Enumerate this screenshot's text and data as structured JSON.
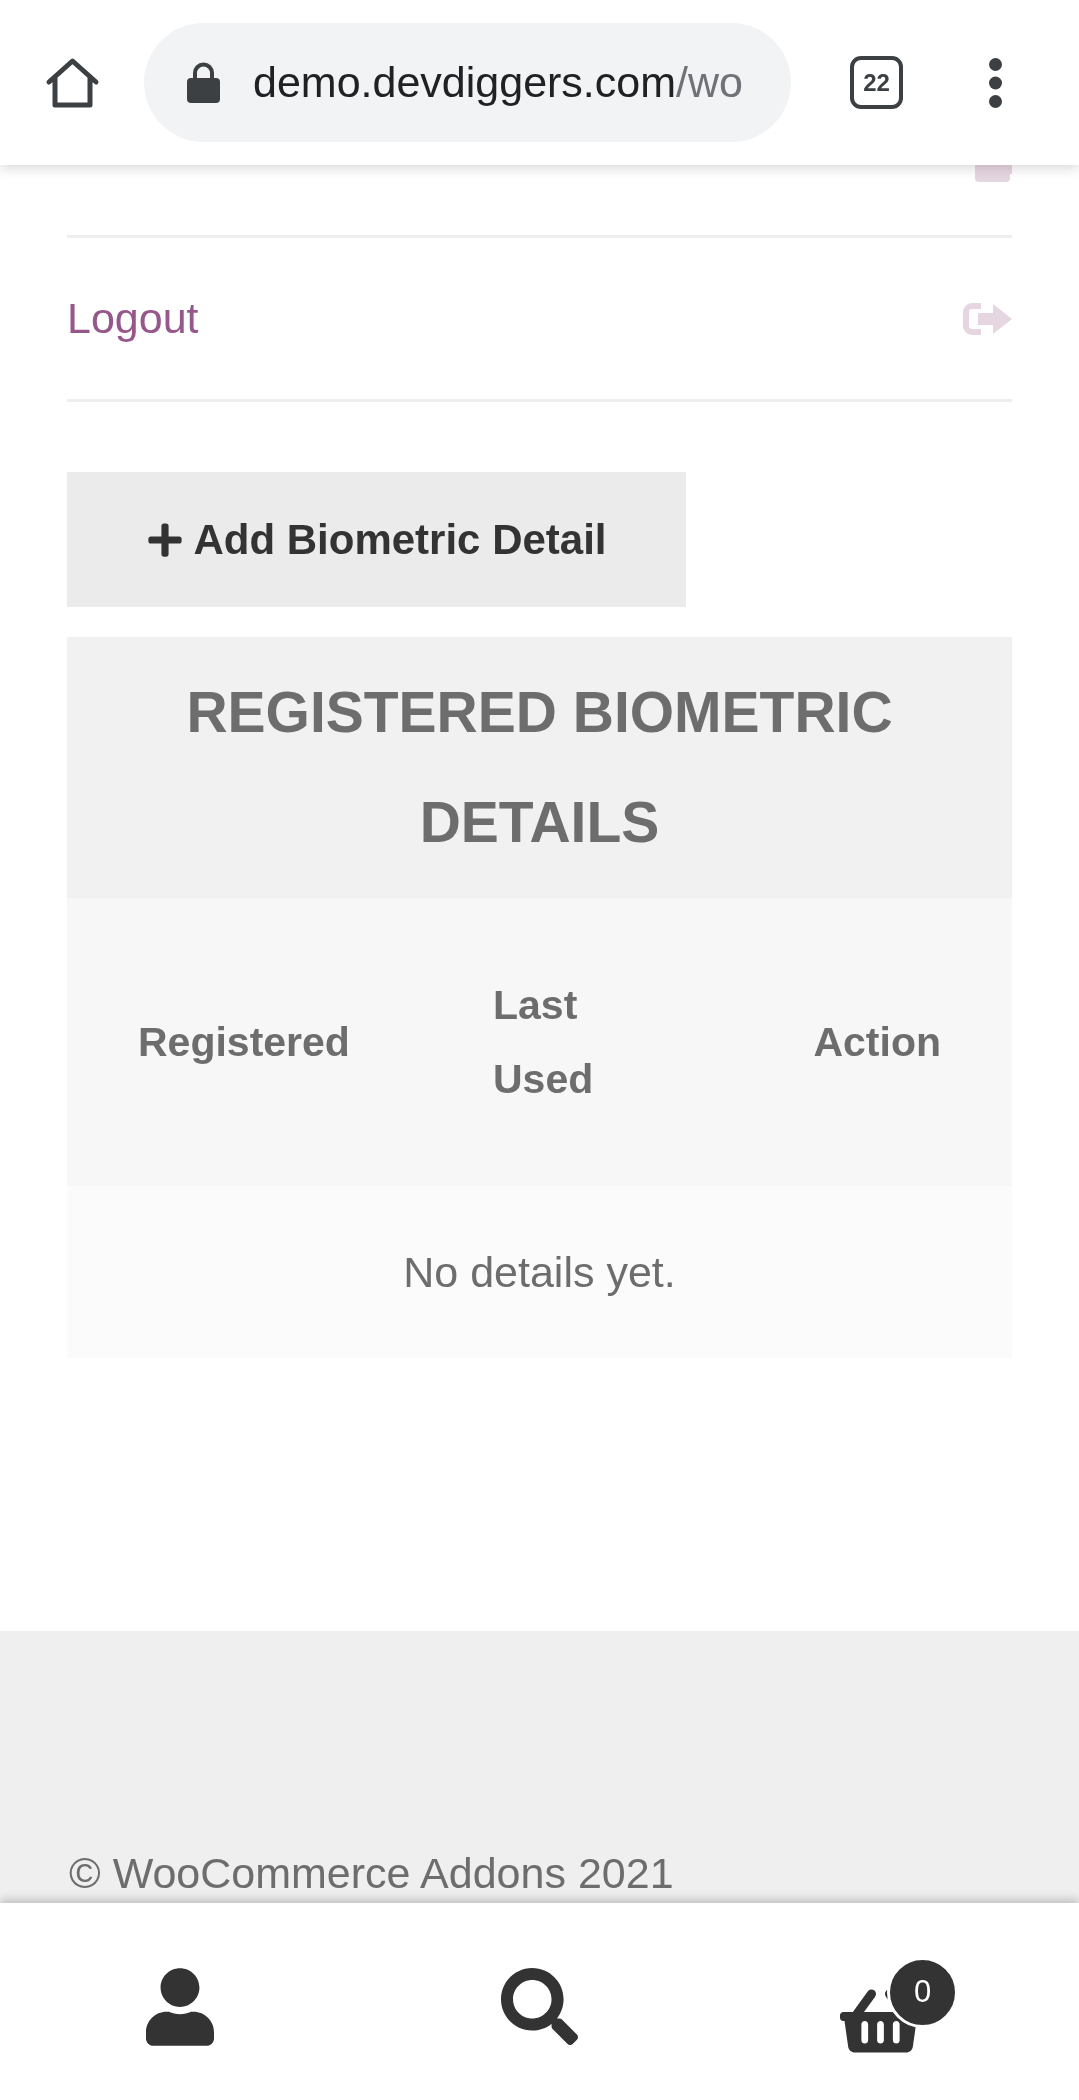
{
  "browser_bar": {
    "url": {
      "host": "demo.devdiggers.com",
      "path": "/wo"
    },
    "tab_count": "22"
  },
  "account_menu": [
    {
      "kind": "wallet"
    },
    {
      "kind": "logout",
      "label": "Logout"
    }
  ],
  "add_button": {
    "label": "Add Biometric Detail"
  },
  "biometric_table": {
    "title": "REGISTERED BIOMETRIC DETAILS",
    "columns": [
      "Registered",
      "Last Used",
      "Action"
    ],
    "empty_message": "No details yet."
  },
  "footer": {
    "copyright": "© WooCommerce Addons 2021"
  },
  "bottom_nav": [
    {
      "kind": "account"
    },
    {
      "kind": "search"
    },
    {
      "kind": "cart",
      "badge": "0"
    }
  ]
}
